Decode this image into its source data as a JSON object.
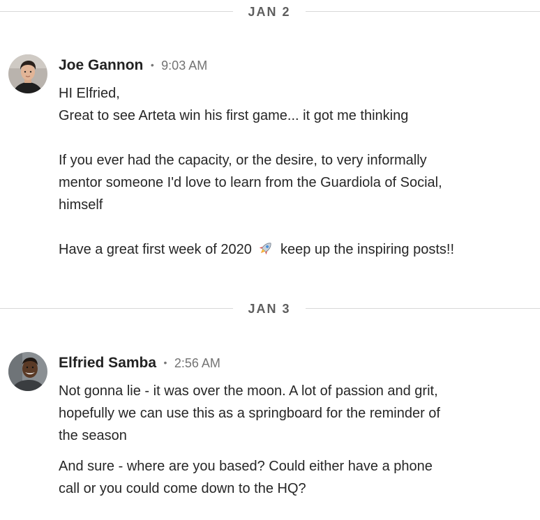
{
  "dividers": [
    {
      "label": "JAN 2"
    },
    {
      "label": "JAN 3"
    }
  ],
  "messages": [
    {
      "sender": "Joe Gannon",
      "separator": "•",
      "time": "9:03 AM",
      "avatar_icon": "person-photo-avatar",
      "lines": {
        "greeting": "HI Elfried,",
        "line2": "Great to see Arteta win his first game... it got me thinking",
        "p2_line1": "If you ever had the capacity, or the desire, to very informally",
        "p2_line2": "mentor someone I'd love to learn from the Guardiola of Social,",
        "p2_line3": "himself",
        "p3_before": "Have a great first week of 2020",
        "p3_emoji": "rocket-emoji",
        "p3_after": "keep up the inspiring posts!!"
      }
    },
    {
      "sender": "Elfried Samba",
      "separator": "•",
      "time": "2:56 AM",
      "avatar_icon": "person-photo-avatar",
      "lines": {
        "p1_line1": "Not gonna lie - it was over the moon. A lot of passion and grit,",
        "p1_line2": "hopefully we can use this as a springboard for the reminder of",
        "p1_line3": "the season",
        "p2_line1": "And sure - where are you based? Could either have a phone",
        "p2_line2": "call or you could come down to the HQ?"
      }
    }
  ],
  "colors": {
    "divider_line": "#d8d8d8",
    "divider_text": "#5e5e5e",
    "name_text": "#222222",
    "time_text": "#737373",
    "body_text": "#262626"
  }
}
